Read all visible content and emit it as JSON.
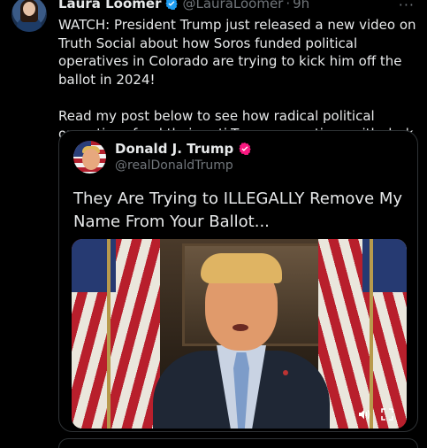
{
  "tweet": {
    "author_name": "Laura Loomer",
    "author_handle": "@LauraLoomer",
    "separator": "·",
    "time": "9h",
    "more_label": "···",
    "text": "WATCH: President Trump just released a new video on Truth Social about how Soros funded political operatives in Colorado are trying to kick him off the ballot in 2024!\n\nRead my post below to see how radical political operatives fund their anti-Trump operations with dark money!"
  },
  "quoted": {
    "author_name": "Donald J. Trump",
    "author_handle": "@realDonaldTrump",
    "text": "They Are Trying to ILLEGALLY Remove My Name From Your Ballot...",
    "video": {
      "volume_icon": "volume-icon",
      "fullscreen_icon": "fullscreen-icon"
    }
  },
  "icons": {
    "verified": "verified-badge-icon",
    "quoted_badge": "gold-verified-icon"
  },
  "colors": {
    "background": "#000000",
    "text": "#e7e9ea",
    "muted": "#71767b",
    "verified_blue": "#1d9bf0",
    "quoted_badge": "#f91880"
  }
}
